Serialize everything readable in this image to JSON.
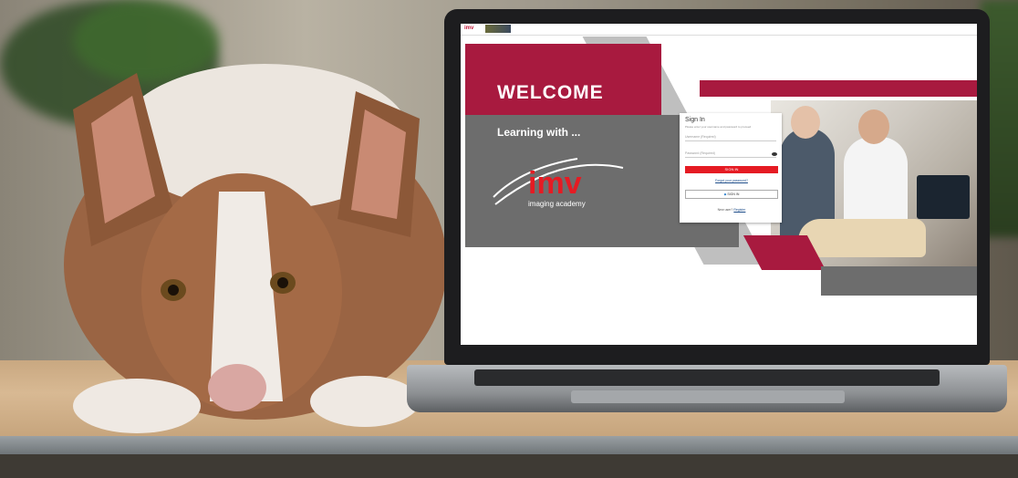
{
  "screen": {
    "topbar": {
      "logo_text": "imv"
    },
    "hero": {
      "welcome": "WELCOME",
      "learning": "Learning with ...",
      "logo": {
        "brand": "imv",
        "tagline": "imaging academy"
      }
    },
    "signin": {
      "title": "Sign In",
      "subtitle": "Please enter your username and password to proceed",
      "username_placeholder": "Username (Required)",
      "password_placeholder": "Password (Required)",
      "signin_button": "SIGN IN",
      "forgot_link": "Forgot your password?",
      "sso_button": "SIGN IN",
      "new_user_prompt": "New user?",
      "register_link": "Register"
    }
  },
  "colors": {
    "brand_red": "#a81a3f",
    "button_red": "#e51b23",
    "panel_gray": "#6d6d6d",
    "link_blue": "#1f4e8a"
  },
  "icons": [
    "eye-icon",
    "sso-icon"
  ]
}
